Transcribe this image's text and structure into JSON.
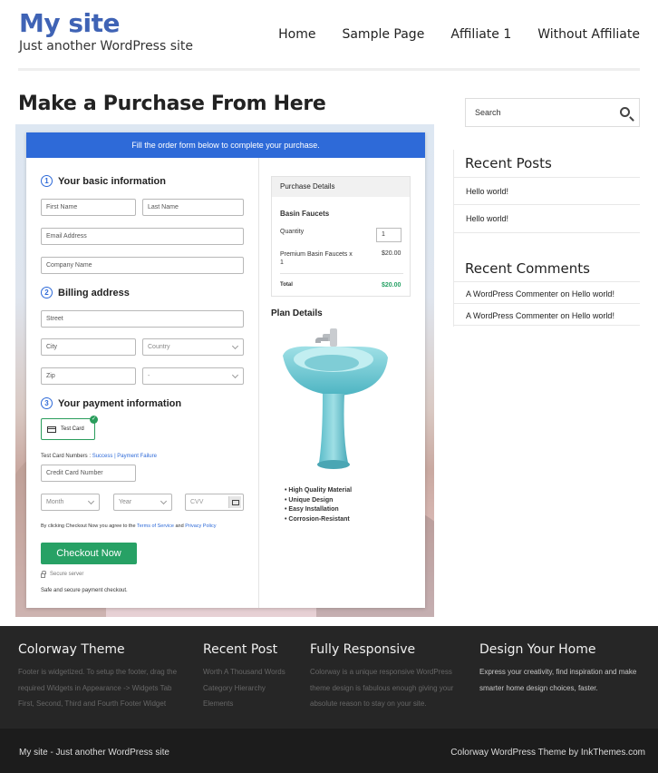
{
  "site": {
    "title": "My site",
    "tagline": "Just another WordPress site"
  },
  "nav": [
    {
      "label": "Home"
    },
    {
      "label": "Sample Page"
    },
    {
      "label": "Affiliate 1"
    },
    {
      "label": "Without Affiliate"
    }
  ],
  "page": {
    "heading": "Make a Purchase From Here"
  },
  "order_form": {
    "banner": "Fill the order form below to complete your purchase.",
    "step1": {
      "num": "1",
      "title": "Your basic information"
    },
    "step2": {
      "num": "2",
      "title": "Billing address"
    },
    "step3": {
      "num": "3",
      "title": "Your payment information"
    },
    "fields": {
      "first_name": "First Name",
      "last_name": "Last Name",
      "email": "Email Address",
      "company": "Company Name",
      "street": "Street",
      "city": "City",
      "country": "Country",
      "zip": "Zip",
      "state": "-",
      "card_number": "Credit Card Number",
      "month": "Month",
      "year": "Year",
      "cvv": "CVV"
    },
    "test_card_label": "Test Card",
    "test_numbers_prefix": "Test Card Numbers :",
    "test_success": "Success",
    "test_separator": "|",
    "test_failure": "Payment Failure",
    "agree_prefix": "By clicking Checkout Now you agree to the",
    "terms_link": "Terms of Service",
    "agree_and": "and",
    "privacy_link": "Privacy Policy",
    "checkout_button": "Checkout Now",
    "secure_label": "Secure server",
    "safe_note": "Safe and secure payment checkout."
  },
  "purchase_details": {
    "heading": "Purchase Details",
    "product": "Basin Faucets",
    "quantity_label": "Quantity",
    "quantity_value": "1",
    "line_item": "Premium Basin Faucets x",
    "line_item_qty": "1",
    "line_price": "$20.00",
    "total_label": "Total",
    "total_value": "$20.00"
  },
  "plan": {
    "title": "Plan Details",
    "features": [
      "High Quality Material",
      "Unique Design",
      "Easy Installation",
      "Corrosion-Resistant"
    ]
  },
  "sidebar": {
    "search_placeholder": "Search",
    "recent_posts_title": "Recent Posts",
    "recent_posts": [
      "Hello world!",
      "Hello world!"
    ],
    "recent_comments_title": "Recent Comments",
    "recent_comments": [
      {
        "author": "A WordPress Commenter",
        "on": "on",
        "post": "Hello world!"
      },
      {
        "author": "A WordPress Commenter",
        "on": "on",
        "post": "Hello world!"
      }
    ]
  },
  "footer": {
    "col1": {
      "title": "Colorway Theme",
      "lines": [
        "Footer is widgetized. To setup the footer, drag the",
        "required Widgets in Appearance -> Widgets Tab",
        "First, Second, Third and Fourth Footer Widget"
      ]
    },
    "col2": {
      "title": "Recent Post",
      "lines": [
        "Worth A Thousand Words",
        "Category Hierarchy",
        "Elements"
      ]
    },
    "col3": {
      "title": "Fully Responsive",
      "lines": [
        "Colorway is a unique responsive WordPress",
        "theme design is fabulous enough giving your",
        "absolute reason to stay on your site."
      ]
    },
    "col4": {
      "title": "Design Your Home",
      "lines": [
        "Express your creativity, find inspiration and make",
        "smarter home design choices, faster."
      ]
    },
    "bottom_left": "My site - Just another WordPress site",
    "bottom_right": "Colorway WordPress Theme by InkThemes.com"
  },
  "colors": {
    "brand": "#3f63b5",
    "banner": "#2e6ad8",
    "checkout": "#27a165",
    "total": "#27a165"
  }
}
